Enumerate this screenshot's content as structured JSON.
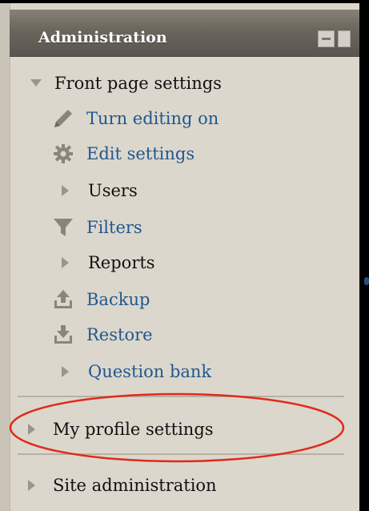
{
  "block": {
    "title": "Administration",
    "controls": [
      "dock-icon",
      "collapse-icon"
    ]
  },
  "tree": {
    "front_page": {
      "label": "Front page settings",
      "expanded": true,
      "children": [
        {
          "label": "Turn editing on",
          "icon": "pencil-icon",
          "link": true
        },
        {
          "label": "Edit settings",
          "icon": "gear-icon",
          "link": true
        },
        {
          "label": "Users",
          "icon": "triangle-right-icon",
          "link": false
        },
        {
          "label": "Filters",
          "icon": "funnel-icon",
          "link": true
        },
        {
          "label": "Reports",
          "icon": "triangle-right-icon",
          "link": false
        },
        {
          "label": "Backup",
          "icon": "upload-icon",
          "link": true
        },
        {
          "label": "Restore",
          "icon": "download-icon",
          "link": true
        },
        {
          "label": "Question bank",
          "icon": "triangle-right-icon",
          "link": true
        }
      ]
    },
    "my_profile": {
      "label": "My profile settings",
      "expanded": false
    },
    "site_admin": {
      "label": "Site administration",
      "expanded": false
    }
  },
  "colors": {
    "link": "#22578f",
    "text": "#111111",
    "panel": "#dcd7cc",
    "header": "#6a655d",
    "annotation": "#e02a1a"
  }
}
